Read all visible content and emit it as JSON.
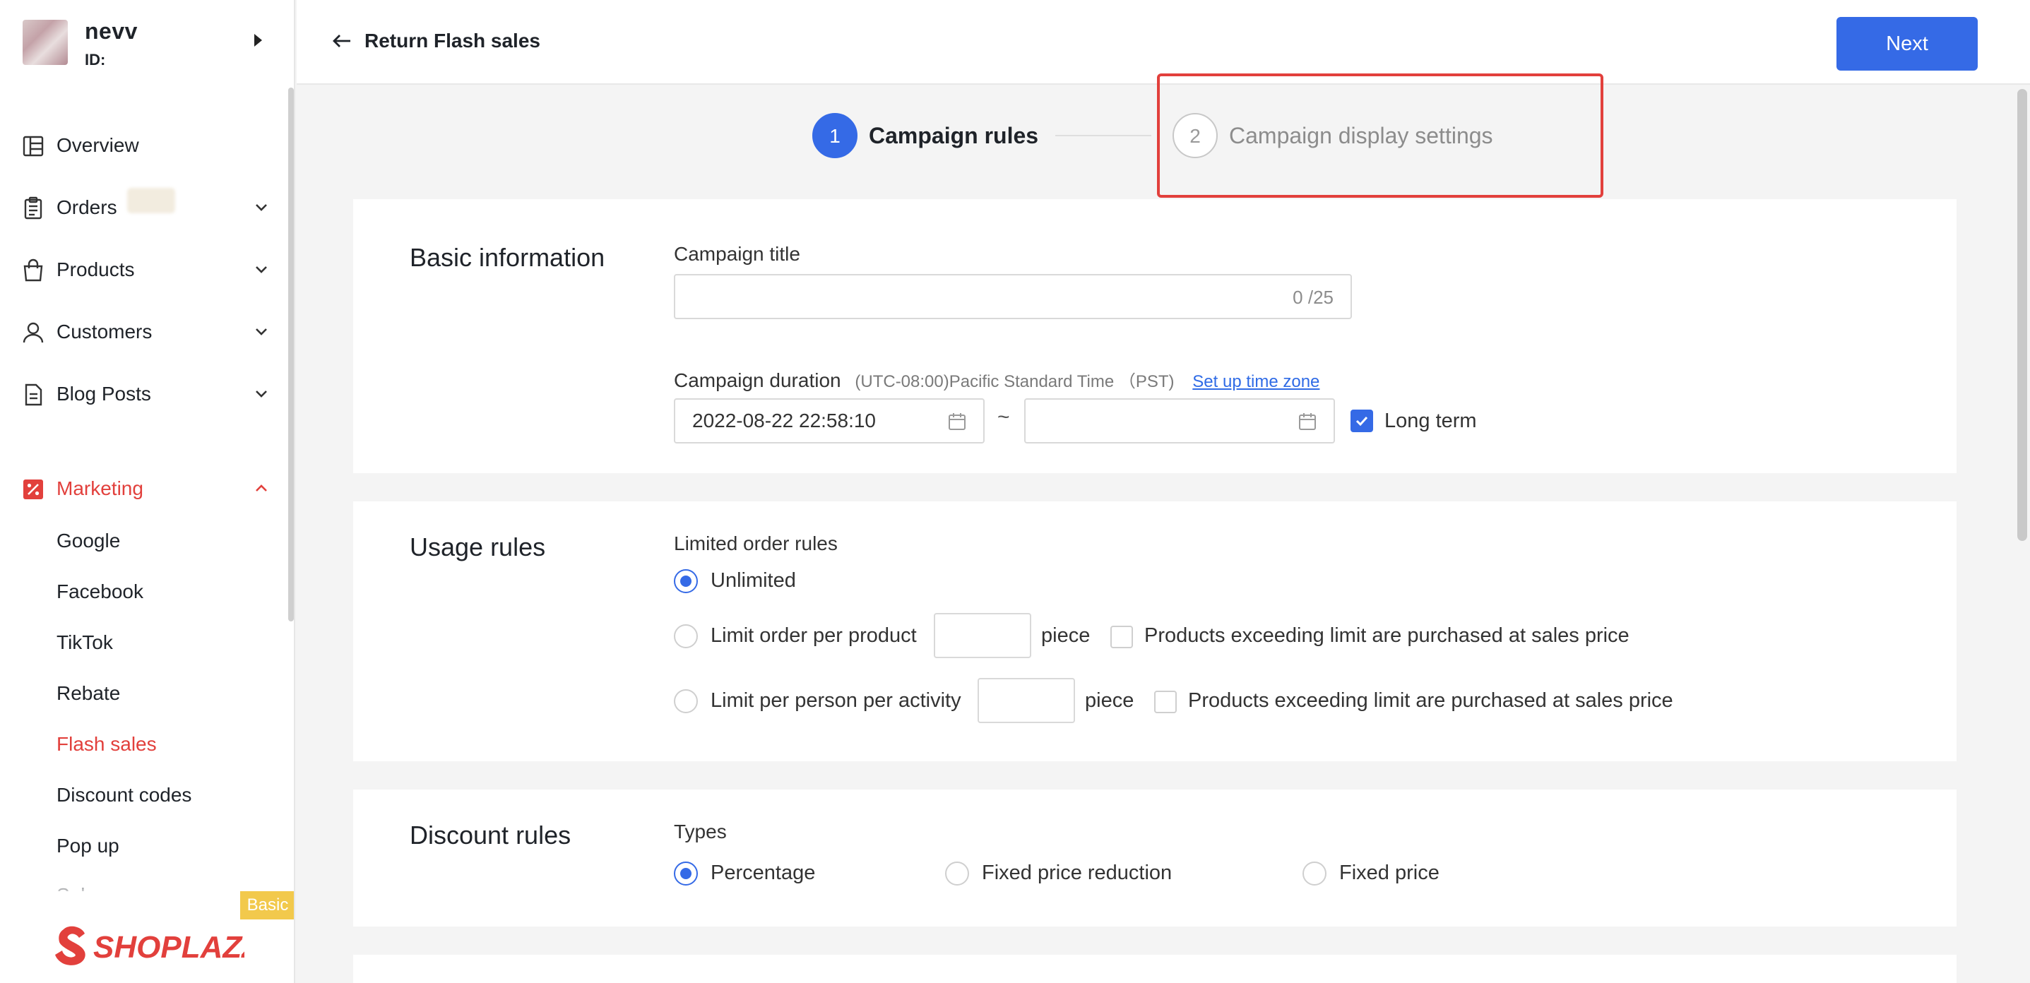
{
  "store": {
    "name": "nevv",
    "id_label": "ID:"
  },
  "sidebar": {
    "items": [
      {
        "label": "Overview"
      },
      {
        "label": "Orders"
      },
      {
        "label": "Products"
      },
      {
        "label": "Customers"
      },
      {
        "label": "Blog Posts"
      },
      {
        "label": "Marketing"
      }
    ],
    "marketing_sub": [
      {
        "label": "Google"
      },
      {
        "label": "Facebook"
      },
      {
        "label": "TikTok"
      },
      {
        "label": "Rebate"
      },
      {
        "label": "Flash sales"
      },
      {
        "label": "Discount codes"
      },
      {
        "label": "Pop up"
      },
      {
        "label": "Sales"
      }
    ],
    "plan_badge": "Basic",
    "logo_text": "SHOPLAZZA",
    "accent_color": "#e2403c"
  },
  "topbar": {
    "back_label": "Return Flash sales",
    "next_label": "Next",
    "primary_color": "#356ae6"
  },
  "steps": [
    {
      "number": "1",
      "label": "Campaign rules"
    },
    {
      "number": "2",
      "label": "Campaign display settings"
    }
  ],
  "basic": {
    "title": "Basic information",
    "campaign_title_label": "Campaign title",
    "campaign_title_value": "",
    "campaign_title_counter": "0 /25",
    "duration_label": "Campaign duration",
    "timezone_text": "(UTC-08:00)Pacific Standard Time （PST)",
    "timezone_link": "Set up time zone",
    "start_date": "2022-08-22 22:58:10",
    "end_date": "",
    "range_separator": "~",
    "long_term_label": "Long term",
    "long_term_checked": true
  },
  "usage": {
    "title": "Usage rules",
    "limited_label": "Limited order rules",
    "options": [
      {
        "label": "Unlimited",
        "selected": true
      },
      {
        "label": "Limit order per product",
        "unit": "piece",
        "exceed": "Products exceeding limit are purchased at sales price"
      },
      {
        "label": "Limit per person per activity",
        "unit": "piece",
        "exceed": "Products exceeding limit are purchased at sales price"
      }
    ]
  },
  "discount": {
    "title": "Discount rules",
    "types_label": "Types",
    "types": [
      {
        "label": "Percentage",
        "selected": true
      },
      {
        "label": "Fixed price reduction"
      },
      {
        "label": "Fixed price"
      }
    ]
  },
  "icons": [
    "caret-right-icon",
    "overview-icon",
    "orders-icon",
    "products-icon",
    "customers-icon",
    "blog-icon",
    "marketing-icon",
    "chevron-down-icon",
    "chevron-up-icon",
    "arrow-left-icon",
    "calendar-icon",
    "check-icon"
  ]
}
